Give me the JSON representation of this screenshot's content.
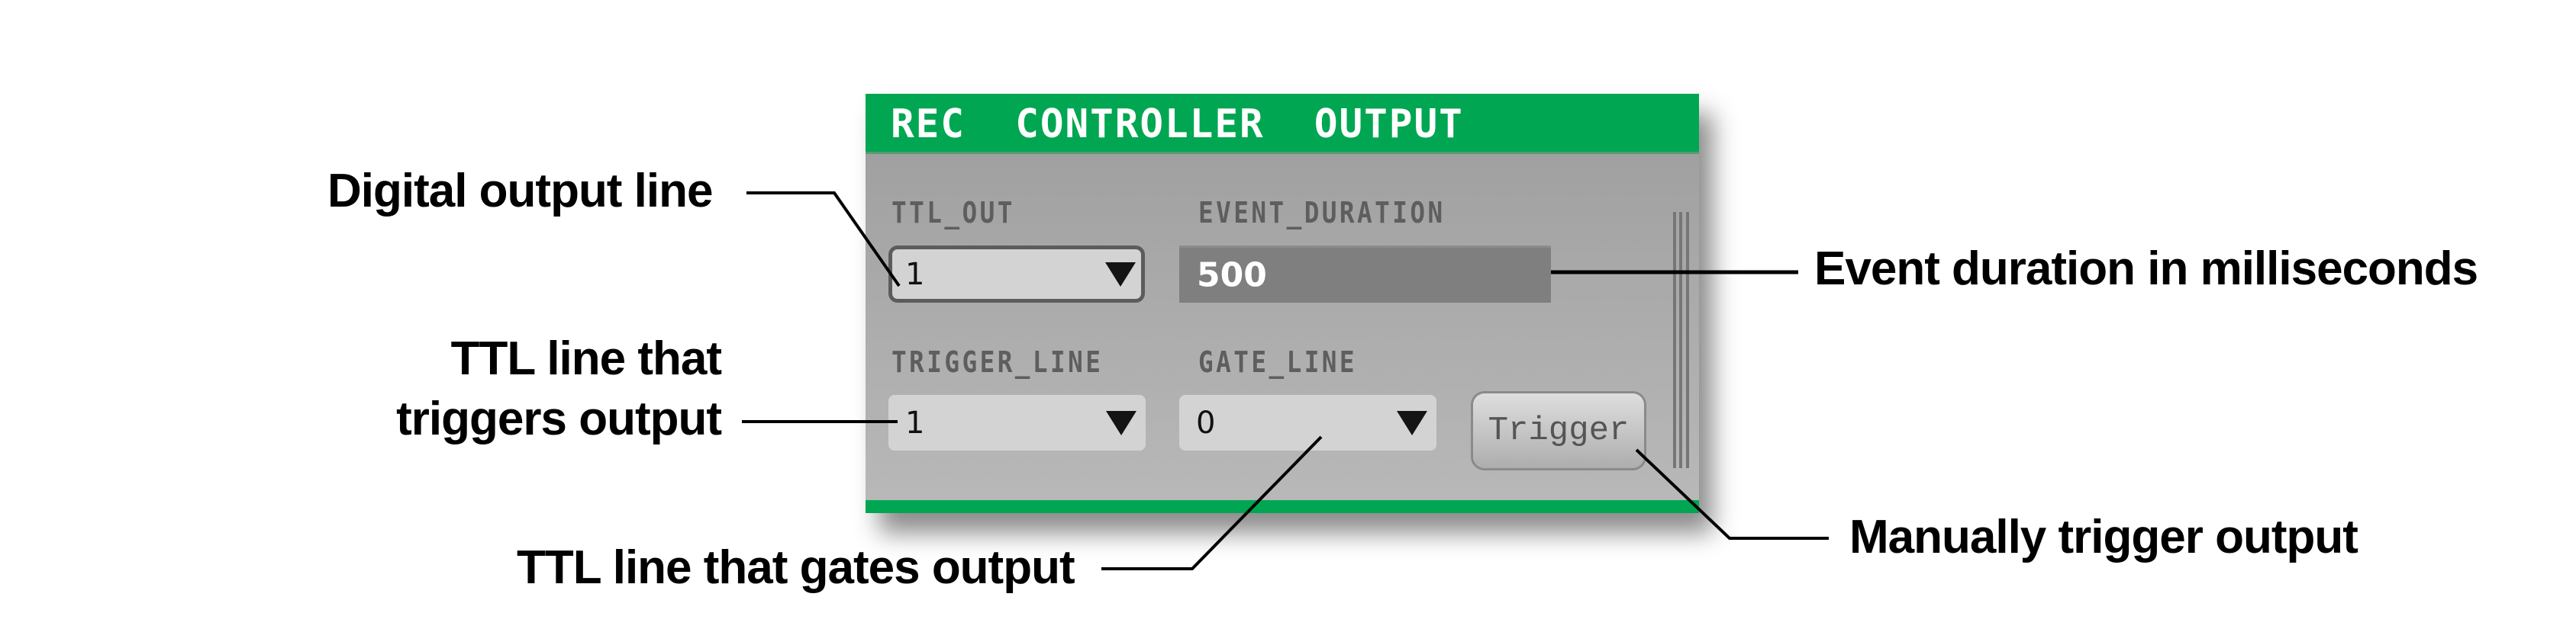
{
  "panel": {
    "title": "REC  CONTROLLER  OUTPUT",
    "accent_color": "#00a651",
    "fields": {
      "ttl_out": {
        "label": "TTL_OUT",
        "value": "1"
      },
      "event_duration": {
        "label": "EVENT_DURATION",
        "value": "500"
      },
      "trigger_line": {
        "label": "TRIGGER_LINE",
        "value": "1"
      },
      "gate_line": {
        "label": "GATE_LINE",
        "value": "0"
      }
    },
    "trigger_button": {
      "label": "Trigger"
    }
  },
  "callouts": {
    "ttl_out": "Digital output line",
    "event_duration": "Event duration in milliseconds",
    "trigger_line_1": "TTL line that",
    "trigger_line_2": "triggers output",
    "gate_line": "TTL line that gates output",
    "trigger_button": "Manually trigger output"
  }
}
